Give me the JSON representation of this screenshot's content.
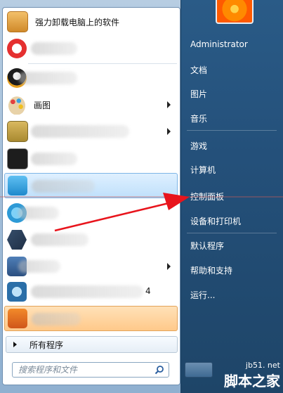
{
  "user": {
    "name": "Administrator"
  },
  "left_menu": {
    "uninstaller_label": "强力卸载电脑上的软件",
    "paint_label": "画图",
    "item_9_suffix": "4",
    "all_programs": "所有程序",
    "search_placeholder": "搜索程序和文件"
  },
  "right_menu": {
    "documents": "文档",
    "pictures": "图片",
    "music": "音乐",
    "games": "游戏",
    "computer": "计算机",
    "control_panel": "控制面板",
    "devices_printers": "设备和打印机",
    "default_programs": "默认程序",
    "help_support": "帮助和支持",
    "run": "运行..."
  },
  "colors": {
    "arrow": "#e8141c",
    "right_panel": "#24507a"
  },
  "watermark": {
    "line1": "jb51. net",
    "line2": "脚本之家"
  }
}
